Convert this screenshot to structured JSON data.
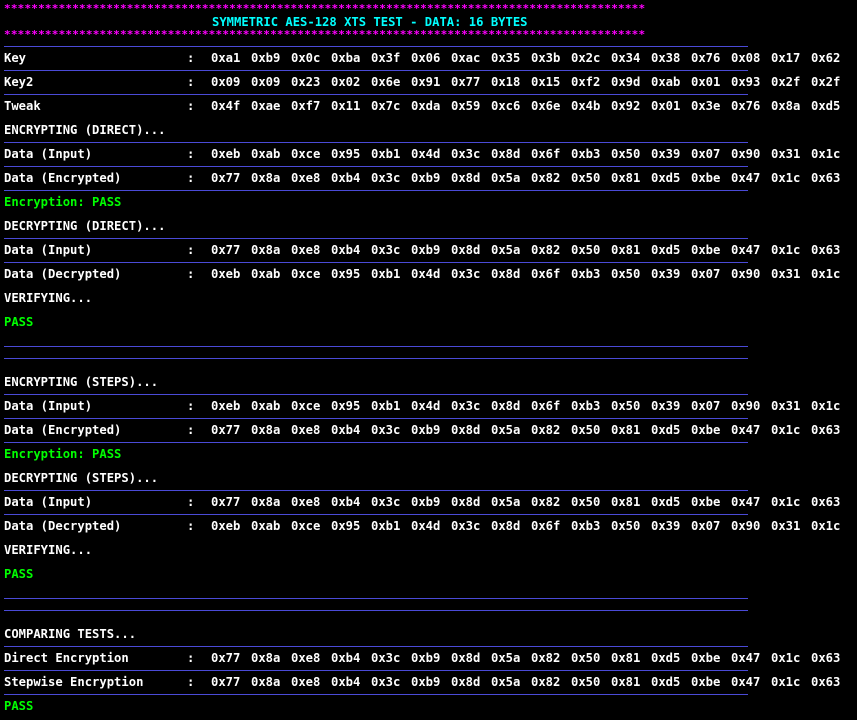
{
  "colors": {
    "background": "#000000",
    "text": "#ffffff",
    "title": "#00ffff",
    "stars": "#ff00ff",
    "pass": "#00ff00",
    "rule": "#4a4ad6"
  },
  "header": {
    "stars": "**********************************************************************************************",
    "title": "SYMMETRIC AES-128 XTS TEST - DATA: 16 BYTES"
  },
  "colon": ":",
  "params": {
    "key": {
      "label": "Key",
      "bytes": [
        "0xa1",
        "0xb9",
        "0x0c",
        "0xba",
        "0x3f",
        "0x06",
        "0xac",
        "0x35",
        "0x3b",
        "0x2c",
        "0x34",
        "0x38",
        "0x76",
        "0x08",
        "0x17",
        "0x62"
      ]
    },
    "key2": {
      "label": "Key2",
      "bytes": [
        "0x09",
        "0x09",
        "0x23",
        "0x02",
        "0x6e",
        "0x91",
        "0x77",
        "0x18",
        "0x15",
        "0xf2",
        "0x9d",
        "0xab",
        "0x01",
        "0x93",
        "0x2f",
        "0x2f"
      ]
    },
    "tweak": {
      "label": "Tweak",
      "bytes": [
        "0x4f",
        "0xae",
        "0xf7",
        "0x11",
        "0x7c",
        "0xda",
        "0x59",
        "0xc6",
        "0x6e",
        "0x4b",
        "0x92",
        "0x01",
        "0x3e",
        "0x76",
        "0x8a",
        "0xd5"
      ]
    }
  },
  "direct": {
    "enc_heading": "ENCRYPTING (DIRECT)...",
    "enc_input": {
      "label": "Data (Input)",
      "bytes": [
        "0xeb",
        "0xab",
        "0xce",
        "0x95",
        "0xb1",
        "0x4d",
        "0x3c",
        "0x8d",
        "0x6f",
        "0xb3",
        "0x50",
        "0x39",
        "0x07",
        "0x90",
        "0x31",
        "0x1c"
      ]
    },
    "enc_output": {
      "label": "Data (Encrypted)",
      "bytes": [
        "0x77",
        "0x8a",
        "0xe8",
        "0xb4",
        "0x3c",
        "0xb9",
        "0x8d",
        "0x5a",
        "0x82",
        "0x50",
        "0x81",
        "0xd5",
        "0xbe",
        "0x47",
        "0x1c",
        "0x63"
      ]
    },
    "enc_result": "Encryption: PASS",
    "dec_heading": "DECRYPTING (DIRECT)...",
    "dec_input": {
      "label": "Data (Input)",
      "bytes": [
        "0x77",
        "0x8a",
        "0xe8",
        "0xb4",
        "0x3c",
        "0xb9",
        "0x8d",
        "0x5a",
        "0x82",
        "0x50",
        "0x81",
        "0xd5",
        "0xbe",
        "0x47",
        "0x1c",
        "0x63"
      ]
    },
    "dec_output": {
      "label": "Data (Decrypted)",
      "bytes": [
        "0xeb",
        "0xab",
        "0xce",
        "0x95",
        "0xb1",
        "0x4d",
        "0x3c",
        "0x8d",
        "0x6f",
        "0xb3",
        "0x50",
        "0x39",
        "0x07",
        "0x90",
        "0x31",
        "0x1c"
      ]
    },
    "verify_heading": "VERIFYING...",
    "verify_result": "PASS"
  },
  "steps": {
    "enc_heading": "ENCRYPTING (STEPS)...",
    "enc_input": {
      "label": "Data (Input)",
      "bytes": [
        "0xeb",
        "0xab",
        "0xce",
        "0x95",
        "0xb1",
        "0x4d",
        "0x3c",
        "0x8d",
        "0x6f",
        "0xb3",
        "0x50",
        "0x39",
        "0x07",
        "0x90",
        "0x31",
        "0x1c"
      ]
    },
    "enc_output": {
      "label": "Data (Encrypted)",
      "bytes": [
        "0x77",
        "0x8a",
        "0xe8",
        "0xb4",
        "0x3c",
        "0xb9",
        "0x8d",
        "0x5a",
        "0x82",
        "0x50",
        "0x81",
        "0xd5",
        "0xbe",
        "0x47",
        "0x1c",
        "0x63"
      ]
    },
    "enc_result": "Encryption: PASS",
    "dec_heading": "DECRYPTING (STEPS)...",
    "dec_input": {
      "label": "Data (Input)",
      "bytes": [
        "0x77",
        "0x8a",
        "0xe8",
        "0xb4",
        "0x3c",
        "0xb9",
        "0x8d",
        "0x5a",
        "0x82",
        "0x50",
        "0x81",
        "0xd5",
        "0xbe",
        "0x47",
        "0x1c",
        "0x63"
      ]
    },
    "dec_output": {
      "label": "Data (Decrypted)",
      "bytes": [
        "0xeb",
        "0xab",
        "0xce",
        "0x95",
        "0xb1",
        "0x4d",
        "0x3c",
        "0x8d",
        "0x6f",
        "0xb3",
        "0x50",
        "0x39",
        "0x07",
        "0x90",
        "0x31",
        "0x1c"
      ]
    },
    "verify_heading": "VERIFYING...",
    "verify_result": "PASS"
  },
  "compare": {
    "heading": "COMPARING TESTS...",
    "direct": {
      "label": "Direct Encryption",
      "bytes": [
        "0x77",
        "0x8a",
        "0xe8",
        "0xb4",
        "0x3c",
        "0xb9",
        "0x8d",
        "0x5a",
        "0x82",
        "0x50",
        "0x81",
        "0xd5",
        "0xbe",
        "0x47",
        "0x1c",
        "0x63"
      ]
    },
    "stepwise": {
      "label": "Stepwise Encryption",
      "bytes": [
        "0x77",
        "0x8a",
        "0xe8",
        "0xb4",
        "0x3c",
        "0xb9",
        "0x8d",
        "0x5a",
        "0x82",
        "0x50",
        "0x81",
        "0xd5",
        "0xbe",
        "0x47",
        "0x1c",
        "0x63"
      ]
    },
    "result": "PASS"
  }
}
